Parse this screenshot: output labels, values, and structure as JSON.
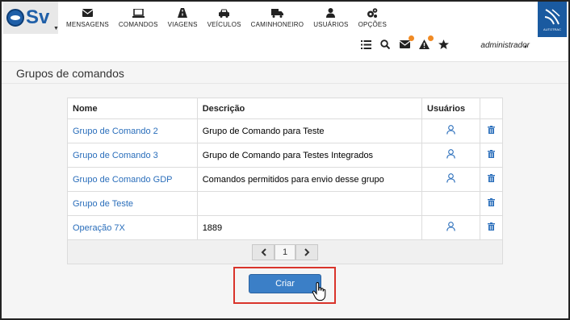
{
  "app": {
    "logo_text": "Sv"
  },
  "nav": {
    "items": [
      {
        "label": "MENSAGENS",
        "icon": "envelope-icon"
      },
      {
        "label": "COMANDOS",
        "icon": "laptop-icon"
      },
      {
        "label": "VIAGENS",
        "icon": "road-icon"
      },
      {
        "label": "VEÍCULOS",
        "icon": "car-icon"
      },
      {
        "label": "CAMINHONEIRO",
        "icon": "truck-icon"
      },
      {
        "label": "USUÁRIOS",
        "icon": "user-icon"
      },
      {
        "label": "OPÇÕES",
        "icon": "gears-icon"
      }
    ],
    "brand_text": "AUTOTRAC"
  },
  "toolbar": {
    "user_name": "administrador"
  },
  "page": {
    "title": "Grupos de comandos"
  },
  "table": {
    "headers": {
      "name": "Nome",
      "description": "Descrição",
      "users": "Usuários"
    },
    "rows": [
      {
        "name": "Grupo de Comando 2",
        "description": "Grupo de Comando para Teste",
        "has_users": true
      },
      {
        "name": "Grupo de Comando 3",
        "description": "Grupo de Comando para Testes Integrados",
        "has_users": true
      },
      {
        "name": "Grupo de Comando GDP",
        "description": "Comandos permitidos para envio desse grupo",
        "has_users": true
      },
      {
        "name": "Grupo de Teste",
        "description": "",
        "has_users": false
      },
      {
        "name": "Operação 7X",
        "description": "1889",
        "has_users": true
      }
    ]
  },
  "pagination": {
    "current_page": "1"
  },
  "actions": {
    "create_label": "Criar"
  },
  "colors": {
    "accent": "#3b7fc7",
    "link": "#2a6ebb",
    "highlight": "#d9342b",
    "badge": "#f08a24"
  }
}
